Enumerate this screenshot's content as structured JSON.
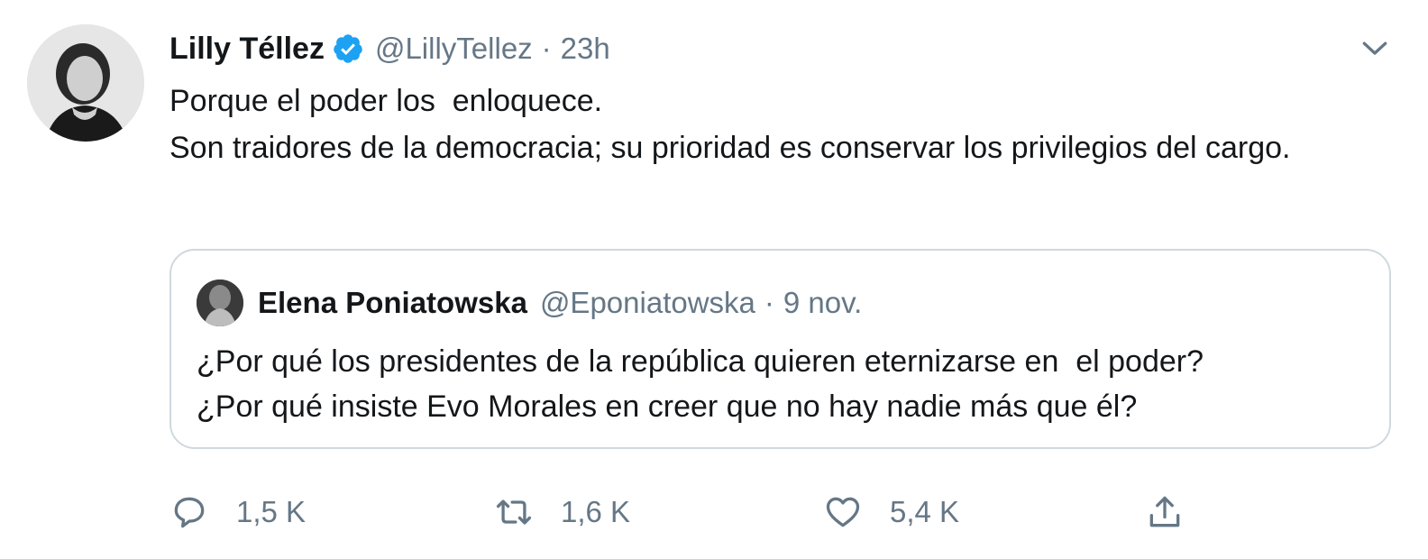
{
  "tweet": {
    "author": {
      "display_name": "Lilly Téllez",
      "handle": "@LillyTellez",
      "verified": true,
      "avatar_icon": "profile-photo"
    },
    "separator": "·",
    "time": "23h",
    "text_lines": [
      "Porque el poder los  enloquece.",
      "Son traidores de la democracia; su prioridad es conservar los privilegios del cargo."
    ],
    "quoted": {
      "display_name": "Elena Poniatowska",
      "handle": "@Eponiatowska",
      "separator": "·",
      "time": "9 nov.",
      "text_lines": [
        "¿Por qué los presidentes de la república quieren eternizarse en  el poder?",
        "¿Por qué insiste Evo Morales en creer que no hay nadie más que él?"
      ]
    },
    "actions": {
      "reply": {
        "icon": "reply-icon",
        "count": "1,5 K"
      },
      "retweet": {
        "icon": "retweet-icon",
        "count": "1,6 K"
      },
      "like": {
        "icon": "heart-icon",
        "count": "5,4 K"
      },
      "share": {
        "icon": "share-icon"
      }
    },
    "colors": {
      "text": "#14171a",
      "secondary": "#657786",
      "verified": "#1da1f2",
      "border": "#cfd9de"
    }
  }
}
